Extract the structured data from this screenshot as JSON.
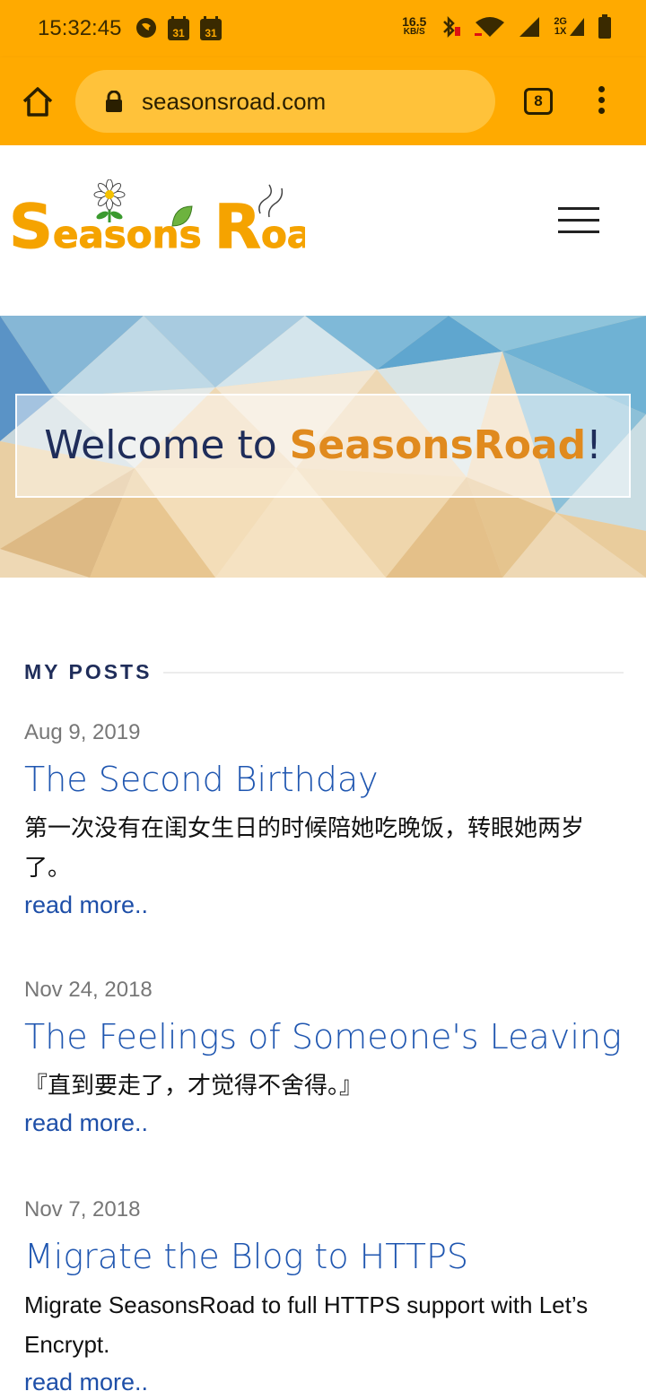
{
  "status_bar": {
    "time": "15:32:45",
    "net_speed": "16.5",
    "net_unit": "KB/S",
    "network_2g": "2G",
    "network_1x": "1X"
  },
  "browser": {
    "url": "seasonsroad.com",
    "tab_count": "8"
  },
  "site": {
    "logo_text": "SeasonsRoad",
    "welcome_prefix": "Welcome to ",
    "welcome_brand": "SeasonsRoad",
    "welcome_suffix": "!"
  },
  "section_title": "MY POSTS",
  "posts": [
    {
      "date": "Aug 9, 2019",
      "title": "The Second Birthday",
      "excerpt": "第一次没有在闺女生日的时候陪她吃晚饭，转眼她两岁了。",
      "link": "read more.."
    },
    {
      "date": "Nov 24, 2018",
      "title": "The Feelings of Someone's Leaving",
      "excerpt": "『直到要走了，才觉得不舍得。』",
      "link": "read more.."
    },
    {
      "date": "Nov 7, 2018",
      "title": "Migrate the Blog to HTTPS",
      "excerpt": "Migrate SeasonsRoad to full HTTPS support with Let’s Encrypt.",
      "link": "read more.."
    }
  ],
  "colors": {
    "browser_bar": "#FFAA00",
    "title_blue": "#1f56b0",
    "brand_orange": "#E08A1E",
    "navy": "#1f2d5a"
  }
}
